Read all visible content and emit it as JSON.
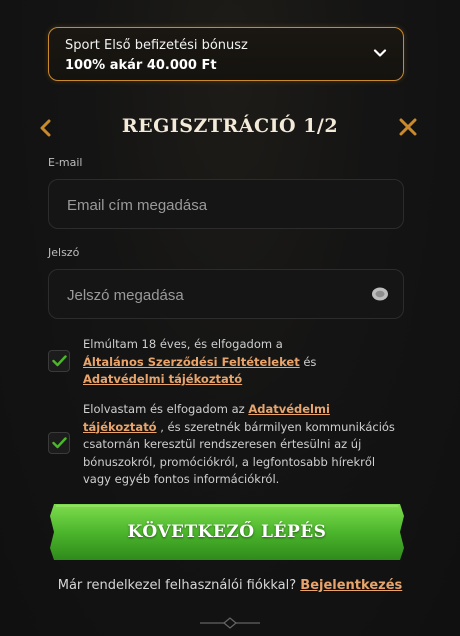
{
  "bonus": {
    "title": "Sport Első befizetési bónusz",
    "value": "100% akár 40.000 Ft",
    "icon": "chevron-down-icon"
  },
  "header": {
    "title": "REGISZTRÁCIÓ 1/2",
    "back_icon": "chevron-left-icon",
    "close_icon": "close-icon",
    "accent": "#c98a2e"
  },
  "email": {
    "label": "E-mail",
    "placeholder": "Email cím megadása",
    "value": ""
  },
  "password": {
    "label": "Jelszó",
    "placeholder": "Jelszó megadása",
    "value": "",
    "icon": "eye-icon"
  },
  "consent1": {
    "checked": true,
    "text_before": "Elmúltam 18 éves, és elfogadom a",
    "link1": "Általános Szerződési Feltételeket",
    "text_mid": "és",
    "link2": "Adatvédelmi tájékoztató"
  },
  "consent2": {
    "checked": true,
    "text_before": "Elolvastam és elfogadom az",
    "link1": "Adatvédelmi tájékoztató",
    "text_after": ", és szeretnék bármilyen kommunikációs csatornán keresztül rendszeresen értesülni az új bónuszokról, promóciókról, a legfontosabb hírekről vagy egyéb fontos információkról."
  },
  "cta": {
    "label": "KÖVETKEZŐ LÉPÉS",
    "color": "#4cb62c"
  },
  "login": {
    "text": "Már rendelkezel felhasználói fiókkal?",
    "link": "Bejelentkezés",
    "link_color": "#e8a46a"
  }
}
